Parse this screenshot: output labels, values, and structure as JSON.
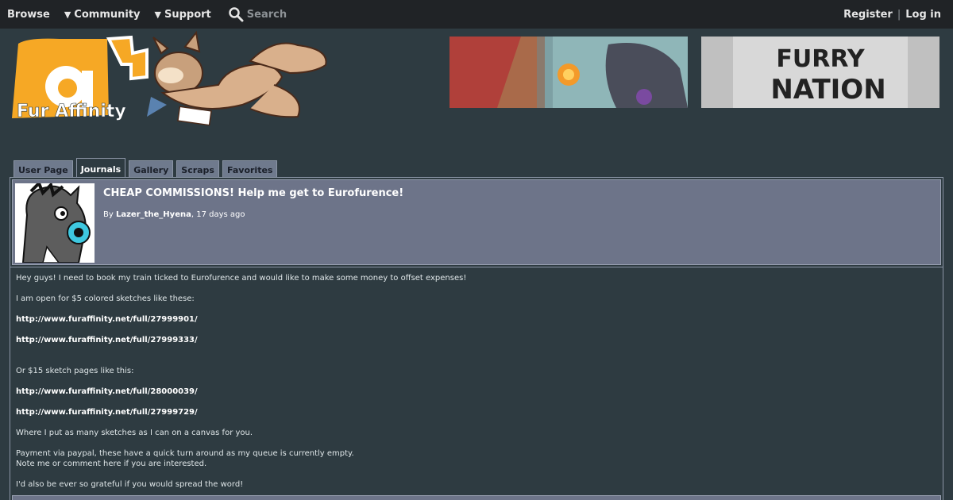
{
  "nav": {
    "browse": "Browse",
    "community": "Community",
    "support": "Support",
    "search": "Search",
    "register": "Register",
    "separator": "|",
    "login": "Log in"
  },
  "logo": {
    "text": "Fur Affinity",
    "letter": "a"
  },
  "banners": {
    "furry_nation": "FURRY NATION"
  },
  "tabs": [
    {
      "label": "User Page",
      "active": false
    },
    {
      "label": "Journals",
      "active": true
    },
    {
      "label": "Gallery",
      "active": false
    },
    {
      "label": "Scraps",
      "active": false
    },
    {
      "label": "Favorites",
      "active": false
    }
  ],
  "journal": {
    "title": "CHEAP COMMISSIONS! Help me get to Eurofurence!",
    "by_prefix": "By ",
    "author": "Lazer_the_Hyena",
    "time": ", 17 days ago",
    "body": [
      {
        "type": "text",
        "text": "Hey guys! I need to book my train ticked to Eurofurence and would like to make some money to offset expenses!"
      },
      {
        "type": "text",
        "text": "I am open for $5 colored sketches like these:"
      },
      {
        "type": "link",
        "text": "http://www.furaffinity.net/full/27999901/"
      },
      {
        "type": "link",
        "text": "http://www.furaffinity.net/full/27999333/"
      },
      {
        "type": "text",
        "text": "Or $15 sketch pages like this:"
      },
      {
        "type": "link",
        "text": "http://www.furaffinity.net/full/28000039/"
      },
      {
        "type": "link",
        "text": "http://www.furaffinity.net/full/27999729/"
      },
      {
        "type": "text",
        "text": "Where I put as many sketches as I can on a canvas for you."
      },
      {
        "type": "text",
        "text": "Payment via paypal, these have a quick turn around as my queue is currently empty."
      },
      {
        "type": "text",
        "text": "Note me or comment here if you are interested."
      },
      {
        "type": "text",
        "text": "I'd also be ever so grateful if you would spread the word!"
      }
    ]
  },
  "colors": {
    "background": "#2e3b41",
    "topbar": "#202326",
    "header_panel": "#6d7489",
    "logo_orange": "#f6a825"
  }
}
